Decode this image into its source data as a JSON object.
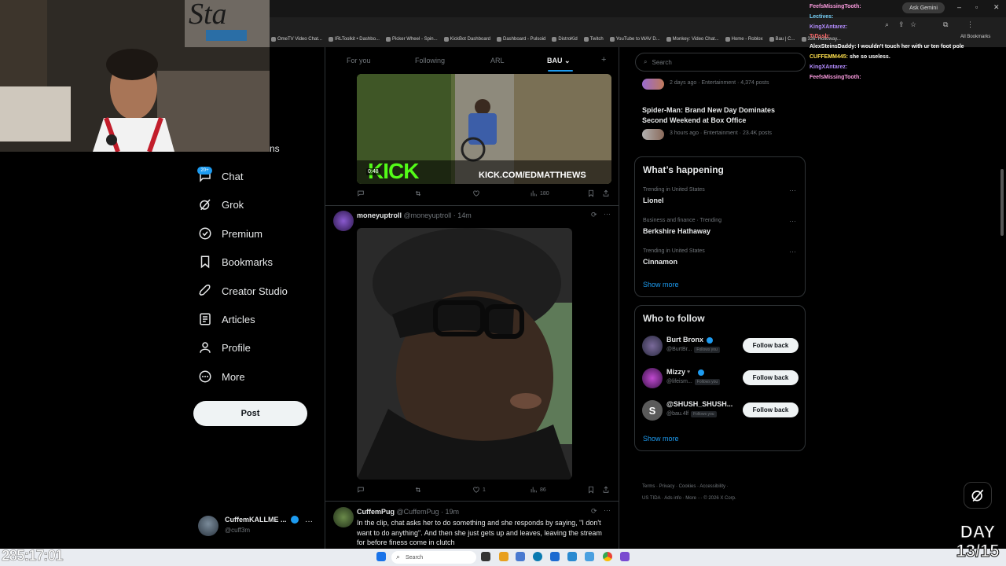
{
  "browser": {
    "ask_gemini": "Ask Gemini",
    "all_bookmarks": "All Bookmarks",
    "bookmarks": [
      "OmeTV Video Chat...",
      "IRLToolkit • Dashbo...",
      "Picker Wheel - Spin...",
      "KickBot Dashboard",
      "Dashboard - Pulsoid",
      "DistroKid",
      "Twitch",
      "YouTube to WAV D...",
      "Monkey: Video Chat...",
      "Home - Roblox",
      "Bau | C...",
      "326: Holloway..."
    ]
  },
  "nav": {
    "badge": "20+",
    "partial_label": "ns",
    "items": [
      {
        "label": "Chat",
        "icon": "chat-icon"
      },
      {
        "label": "Grok",
        "icon": "grok-icon"
      },
      {
        "label": "Premium",
        "icon": "premium-icon"
      },
      {
        "label": "Bookmarks",
        "icon": "bookmark-icon"
      },
      {
        "label": "Creator Studio",
        "icon": "rocket-icon"
      },
      {
        "label": "Articles",
        "icon": "articles-icon"
      },
      {
        "label": "Profile",
        "icon": "profile-icon"
      },
      {
        "label": "More",
        "icon": "more-circle-icon"
      }
    ],
    "post_label": "Post",
    "account": {
      "name": "CuffemKALLME ...",
      "handle": "@cuff3m"
    }
  },
  "feed": {
    "tabs": [
      "For you",
      "Following",
      "ARL",
      "BAU"
    ],
    "tab_plus": "+",
    "video1": {
      "duration": "0:48",
      "overlay_brand": "KICK",
      "overlay_url": "KICK.COM/EDMATTHEWS",
      "views": "180"
    },
    "post2": {
      "name": "moneyuptroll",
      "handle": "@moneyuptroll",
      "time": "14m",
      "likes": "1",
      "views": "86"
    },
    "post3": {
      "name": "CuffemPug",
      "handle": "@CuffemPug",
      "time": "19m",
      "text": "In the clip, chat asks her to do something and she responds by saying, \"I don't want to do anything\". And then she just gets up and leaves, leaving the stream for before finess come in clutch"
    }
  },
  "right": {
    "search_placeholder": "Search",
    "trend_top": {
      "meta": "2 days ago · Entertainment · 4,374 posts"
    },
    "trend_news": {
      "title": "Spider-Man: Brand New Day Dominates Second Weekend at Box Office",
      "meta": "3 hours ago · Entertainment · 23.4K posts"
    },
    "whats_happening": "What’s happening",
    "trends": [
      {
        "context": "Trending in United States",
        "name": "Lionel"
      },
      {
        "context": "Business and finance · Trending",
        "name": "Berkshire Hathaway"
      },
      {
        "context": "Trending in United States",
        "name": "Cinnamon"
      }
    ],
    "show_more": "Show more",
    "who_to_follow": "Who to follow",
    "follows": [
      {
        "name": "Burt Bronx",
        "handle": "@BurtBr...",
        "tag": "Follows you",
        "button": "Follow back"
      },
      {
        "name": "Mizzy",
        "handle": "@lifeism...",
        "tag": "Follows you",
        "button": "Follow back"
      },
      {
        "name": "@SHUSH_SHUSH...",
        "handle": "@bau.4lf",
        "tag": "Follows you",
        "button": "Follow back",
        "initial": "S"
      }
    ],
    "show_more2": "Show more",
    "footer": {
      "line1": "Terms · Privacy · Cookies · Accessibility ·",
      "line2": "US TIDA · Ads info · More ··· © 2026 X Corp."
    }
  },
  "chat": [
    {
      "user": "FeefsMissingTooth:",
      "msg": "",
      "color": "#ff9de2"
    },
    {
      "user": "Lectives:",
      "msg": "",
      "color": "#7ad6ff"
    },
    {
      "user": "KingXAntarez:",
      "msg": "",
      "color": "#b48cff"
    },
    {
      "user": "TrDssb:",
      "msg": "",
      "color": "#ff6a6a"
    },
    {
      "user": "AlexSteinsDaddy:",
      "msg": "I wouldn't touch her with ur ten foot pole",
      "color": "#ffffff"
    },
    {
      "user": "CUFFEMM445:",
      "msg": "she so useless.",
      "color": "#ffe04d"
    },
    {
      "user": "KingXAntarez:",
      "msg": "",
      "color": "#b48cff"
    },
    {
      "user": "FeefsMissingTooth:",
      "msg": "",
      "color": "#ff9de2"
    }
  ],
  "stream": {
    "timer": "285:17:01",
    "day_line1": "DAY",
    "day_line2": "13/15"
  },
  "taskbar": {
    "search": "Search"
  },
  "colors": {
    "accent": "#1d9bf0",
    "bg": "#000000",
    "border": "#2f3336",
    "muted": "#71767b"
  }
}
